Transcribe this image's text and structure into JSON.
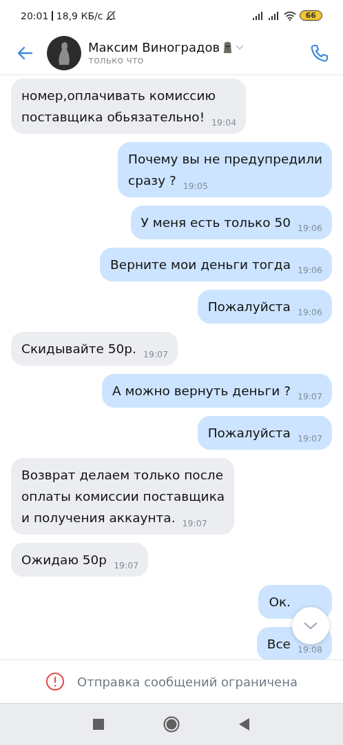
{
  "status_bar": {
    "time": "20:01",
    "speed": "18,9 КБ/с",
    "battery": "66"
  },
  "header": {
    "name": "Максим Виноградов",
    "status": "только что"
  },
  "messages": [
    {
      "kind": "in",
      "text": "номер,оплачивать комиссию\nпоставщика обьязательно!",
      "time": "19:04"
    },
    {
      "kind": "out",
      "text": "Почему вы не предупредили\nсразу ?",
      "time": "19:05"
    },
    {
      "kind": "out",
      "text": "У меня есть только 50",
      "time": "19:06"
    },
    {
      "kind": "out",
      "text": "Верните мои деньги тогда",
      "time": "19:06"
    },
    {
      "kind": "out",
      "text": "Пожалуйста",
      "time": "19:06"
    },
    {
      "kind": "in",
      "text": "Скидывайте 50р.",
      "time": "19:07"
    },
    {
      "kind": "out",
      "text": "А можно вернуть деньги ?",
      "time": "19:07"
    },
    {
      "kind": "out",
      "text": "Пожалуйста",
      "time": "19:07"
    },
    {
      "kind": "in",
      "text": "Возврат делаем только после\nоплаты комиссии поставщика\nи получения аккаунта.",
      "time": "19:07"
    },
    {
      "kind": "in",
      "text": "Ожидаю 50р",
      "time": "19:07"
    },
    {
      "kind": "out",
      "text": "Ок."
    },
    {
      "kind": "out",
      "text": "Все",
      "time": "19:08"
    }
  ],
  "notice": "Отправка сообщений ограничена"
}
